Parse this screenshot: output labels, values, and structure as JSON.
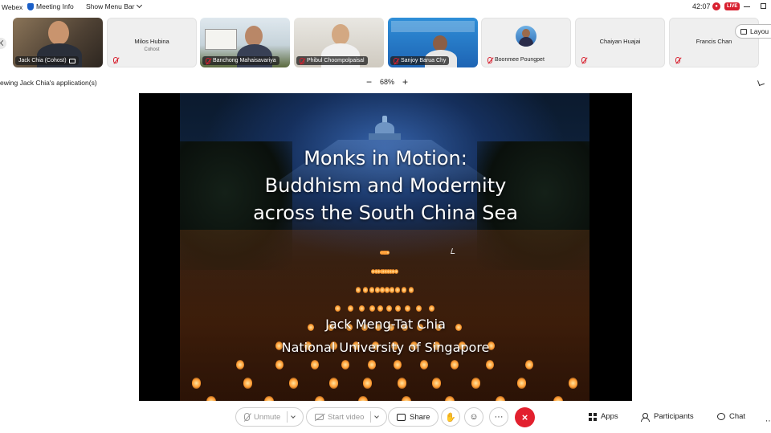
{
  "topbar": {
    "app_name": "Webex",
    "meeting_info": "Meeting Info",
    "show_menu_bar": "Show Menu Bar",
    "timer": "42:07",
    "live_badge": "LIVE"
  },
  "participants": [
    {
      "name": "Jack Chia (Cohost)",
      "video": true
    },
    {
      "name": "Milos Hubina",
      "role": "Cohost",
      "video": false
    },
    {
      "name": "Banchong Mahaisavariya",
      "video": true
    },
    {
      "name": "Phibul Choompolpaisal",
      "video": true
    },
    {
      "name": "Sanjoy Barua Chy",
      "video": true
    },
    {
      "name": "Boonmee Poungpet",
      "video": false
    },
    {
      "name": "Chaiyan Huajai",
      "video": false
    },
    {
      "name": "Francis Chan",
      "video": false
    }
  ],
  "layout_button": "Layou",
  "share_bar": {
    "viewing_text": "ewing Jack Chia's application(s)",
    "zoom_level": "68%",
    "zoom_out": "−",
    "zoom_in": "+"
  },
  "slide": {
    "title_lines": [
      "Monks in Motion:",
      "Buddhism and Modernity",
      "across the South China Sea"
    ],
    "author_lines": [
      "Jack Meng-Tat Chia",
      "National University of Singapore"
    ]
  },
  "controls": {
    "unmute": "Unmute",
    "start_video": "Start video",
    "share": "Share",
    "more": "···",
    "end": "×",
    "apps": "Apps",
    "participants": "Participants",
    "chat": "Chat"
  },
  "colors": {
    "end_red": "#e2202e",
    "live_red": "#d8202f",
    "brand_blue": "#1a5fc8"
  }
}
